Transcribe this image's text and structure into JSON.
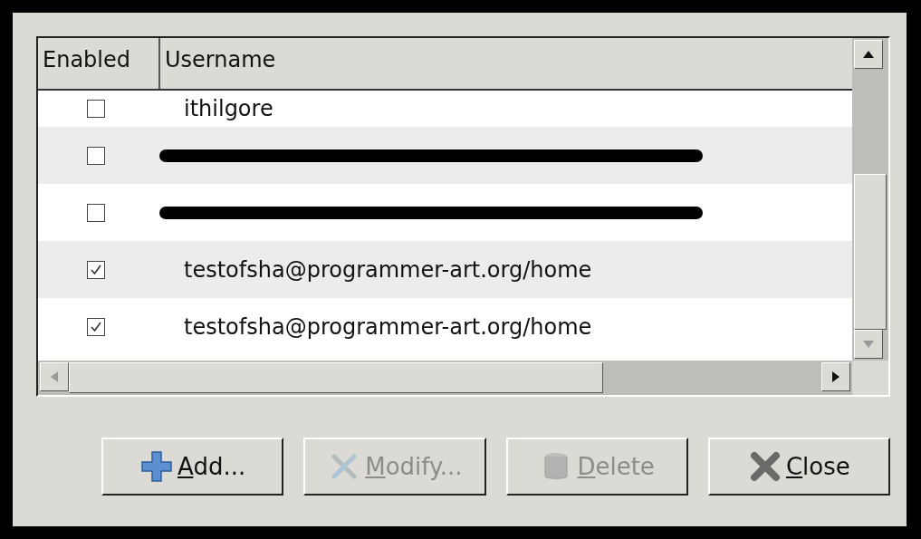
{
  "table": {
    "columns": [
      "Enabled",
      "Username"
    ],
    "rows": [
      {
        "kind": "user",
        "enabled": false,
        "username": "ithilgore"
      },
      {
        "kind": "redacted",
        "enabled": false
      },
      {
        "kind": "redacted",
        "enabled": false
      },
      {
        "kind": "user",
        "enabled": true,
        "username": "testofsha@programmer-art.org/home"
      },
      {
        "kind": "user",
        "enabled": true,
        "username": "testofsha@programmer-art.org/home"
      }
    ]
  },
  "buttons": [
    {
      "kind": "add",
      "label": "Add...",
      "disabled": false
    },
    {
      "kind": "modify",
      "label": "Modify...",
      "disabled": true
    },
    {
      "kind": "delete",
      "label": "Delete",
      "disabled": true
    },
    {
      "kind": "close",
      "label": "Close",
      "disabled": false
    }
  ]
}
